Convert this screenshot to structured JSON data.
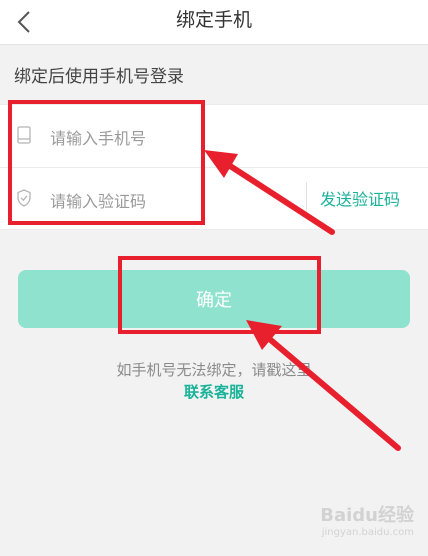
{
  "header": {
    "title": "绑定手机"
  },
  "hint": "绑定后使用手机号登录",
  "form": {
    "phone_placeholder": "请输入手机号",
    "code_placeholder": "请输入验证码",
    "send_code_label": "发送验证码"
  },
  "confirm_label": "确定",
  "footer": {
    "text": "如手机号无法绑定，请戳这里",
    "link": "联系客服"
  },
  "watermark": {
    "logo": "Baidu经验",
    "url": "jingyan.baidu.com"
  },
  "colors": {
    "accent": "#1ab39a",
    "button_bg": "#8fe2cd",
    "annotation_red": "#e8202e"
  }
}
